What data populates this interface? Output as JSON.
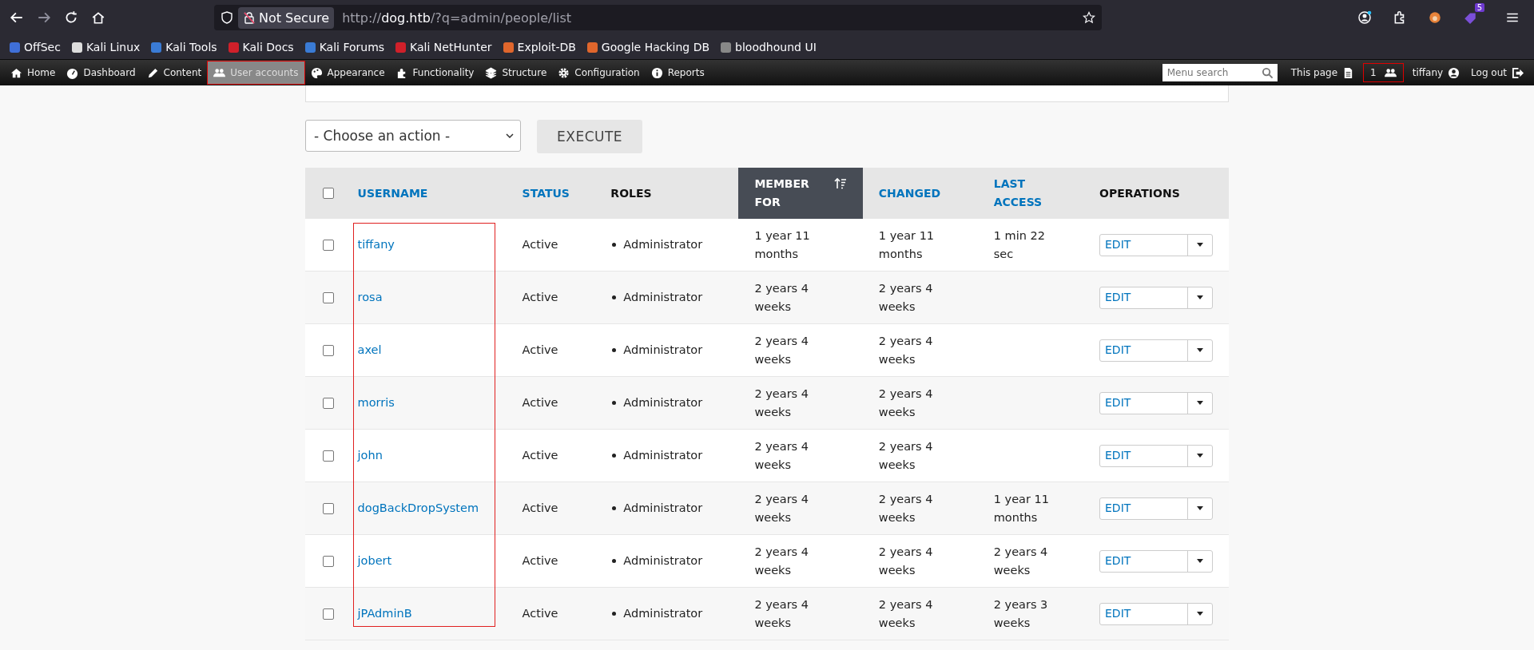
{
  "browser": {
    "url_scheme": "http://",
    "url_host": "dog.htb",
    "url_path": "/?q=admin/people/list",
    "security_label": "Not Secure",
    "extension_badge": "5"
  },
  "bookmarks": [
    {
      "label": "OffSec",
      "color": "#3f6fd8"
    },
    {
      "label": "Kali Linux",
      "color": "#dddddd"
    },
    {
      "label": "Kali Tools",
      "color": "#3a7bd5"
    },
    {
      "label": "Kali Docs",
      "color": "#d0202a"
    },
    {
      "label": "Kali Forums",
      "color": "#3a7bd5"
    },
    {
      "label": "Kali NetHunter",
      "color": "#d0202a"
    },
    {
      "label": "Exploit-DB",
      "color": "#e0662c"
    },
    {
      "label": "Google Hacking DB",
      "color": "#e0662c"
    },
    {
      "label": "bloodhound UI",
      "color": "#888888"
    }
  ],
  "admin_menu": {
    "items": [
      {
        "kind": "home",
        "label": "Home",
        "selected": false
      },
      {
        "kind": "dashboard",
        "label": "Dashboard",
        "selected": false
      },
      {
        "kind": "content",
        "label": "Content",
        "selected": false
      },
      {
        "kind": "people",
        "label": "User accounts",
        "selected": true
      },
      {
        "kind": "appearance",
        "label": "Appearance",
        "selected": false
      },
      {
        "kind": "functionality",
        "label": "Functionality",
        "selected": false
      },
      {
        "kind": "structure",
        "label": "Structure",
        "selected": false
      },
      {
        "kind": "configuration",
        "label": "Configuration",
        "selected": false
      },
      {
        "kind": "reports",
        "label": "Reports",
        "selected": false
      }
    ],
    "search_placeholder": "Menu search",
    "this_page": "This page",
    "users_online": "1",
    "user": "tiffany",
    "logout": "Log out"
  },
  "bulk": {
    "action_placeholder": "- Choose an action -",
    "execute": "EXECUTE"
  },
  "table": {
    "select_all_checked": false,
    "columns": [
      {
        "label": "USERNAME",
        "sortable": true,
        "selected": false
      },
      {
        "label": "STATUS",
        "sortable": true,
        "selected": false
      },
      {
        "label": "ROLES",
        "sortable": false,
        "selected": false
      },
      {
        "label": "MEMBER FOR",
        "sortable": true,
        "selected": true
      },
      {
        "label": "CHANGED",
        "sortable": true,
        "selected": false
      },
      {
        "label": "LAST ACCESS",
        "sortable": true,
        "selected": false
      },
      {
        "label": "OPERATIONS",
        "sortable": false,
        "selected": false
      }
    ],
    "rows": [
      {
        "checked": false,
        "username": "tiffany",
        "status": "Active",
        "roles": [
          "Administrator"
        ],
        "member_for": "1 year 11 months",
        "changed": "1 year 11 months",
        "last_access": "1 min 22 sec",
        "operation": "EDIT"
      },
      {
        "checked": false,
        "username": "rosa",
        "status": "Active",
        "roles": [
          "Administrator"
        ],
        "member_for": "2 years 4 weeks",
        "changed": "2 years 4 weeks",
        "operation": "EDIT"
      },
      {
        "checked": false,
        "username": "axel",
        "status": "Active",
        "roles": [
          "Administrator"
        ],
        "member_for": "2 years 4 weeks",
        "changed": "2 years 4 weeks",
        "operation": "EDIT"
      },
      {
        "checked": false,
        "username": "morris",
        "status": "Active",
        "roles": [
          "Administrator"
        ],
        "member_for": "2 years 4 weeks",
        "changed": "2 years 4 weeks",
        "operation": "EDIT"
      },
      {
        "checked": false,
        "username": "john",
        "status": "Active",
        "roles": [
          "Administrator"
        ],
        "member_for": "2 years 4 weeks",
        "changed": "2 years 4 weeks",
        "operation": "EDIT"
      },
      {
        "checked": false,
        "username": "dogBackDropSystem",
        "status": "Active",
        "roles": [
          "Administrator"
        ],
        "member_for": "2 years 4 weeks",
        "changed": "2 years 4 weeks",
        "last_access": "1 year 11 months",
        "operation": "EDIT"
      },
      {
        "checked": false,
        "username": "jobert",
        "status": "Active",
        "roles": [
          "Administrator"
        ],
        "member_for": "2 years 4 weeks",
        "changed": "2 years 4 weeks",
        "last_access": "2 years 4 weeks",
        "operation": "EDIT"
      },
      {
        "checked": false,
        "username": "jPAdminB",
        "status": "Active",
        "roles": [
          "Administrator"
        ],
        "member_for": "2 years 4 weeks",
        "changed": "2 years 4 weeks",
        "last_access": "2 years 3 weeks",
        "operation": "EDIT"
      }
    ]
  }
}
